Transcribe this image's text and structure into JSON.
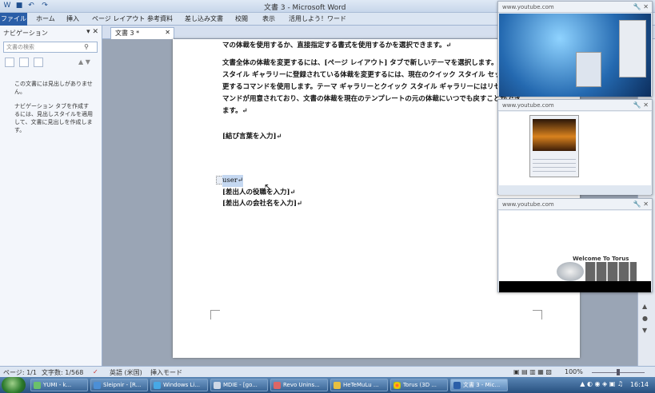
{
  "window": {
    "title": "文書 3 - Microsoft Word"
  },
  "ribbon": {
    "tabs": [
      "ファイル",
      "ホーム",
      "挿入",
      "ページ レイアウト",
      "参考資料",
      "差し込み文書",
      "校閲",
      "表示",
      "活用しよう！ワード"
    ]
  },
  "nav": {
    "title": "ナビゲーション",
    "search_placeholder": "文書の検索",
    "msg1": "この文書には見出しがありません。",
    "msg2": "ナビゲーション タブを作成するには、見出しスタイルを適用して、文書に見出しを作成します。"
  },
  "doc": {
    "tab_label": "文書 3 *",
    "line1": "マの体裁を使用するか、直接指定する書式を使用するかを選択できます。↵",
    "para2": "文書全体の体裁を変更するには、[ページ レイアウト] タブで新しいテーマを選択します。クイック スタイル ギャラリーに登録されている体裁を変更するには、現在のクイック スタイル セットを変更するコマンドを使用します。テーマ ギャラリーとクイック スタイル ギャラリーにはリセット コマンドが用意されており、文書の体裁を現在のテンプレートの元の体裁にいつでも戻すことができます。↵",
    "closing": "[結び言葉を入力]↵",
    "sender": "user↵",
    "title_line": "[差出人の役職を入力]↵",
    "company_line": "[差出人の会社名を入力]↵"
  },
  "status": {
    "page": "ページ: 1/1",
    "words": "文字数: 1/568",
    "lang": "英語 (米国)",
    "mode": "挿入モード",
    "zoom": "100%"
  },
  "taskbar": {
    "items": [
      "YUMI - k...",
      "Sleipnir - [R...",
      "Windows Li...",
      "MDIE - [go...",
      "Revo Unins...",
      "HeTeMuLu ...",
      "Torus (3D ...",
      "文書 3 - Mic..."
    ],
    "clock": "16:14"
  },
  "popups": [
    {
      "url": "www.youtube.com"
    },
    {
      "url": "www.youtube.com"
    },
    {
      "url": "www.youtube.com",
      "caption": "Welcome To Torus"
    }
  ]
}
